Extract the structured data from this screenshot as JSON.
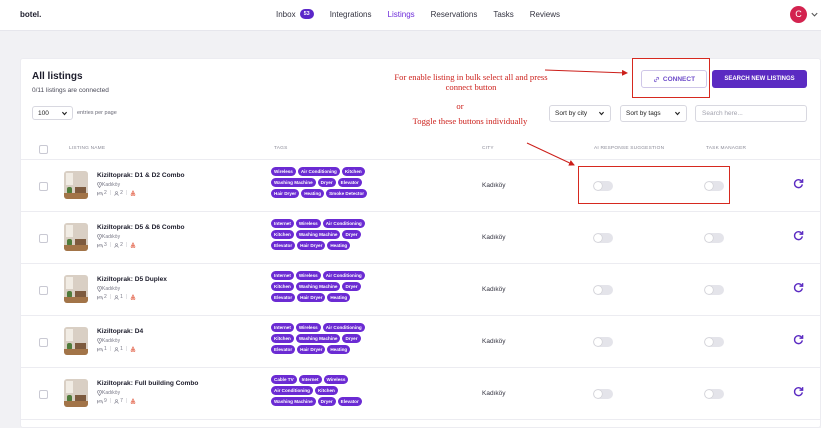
{
  "app": {
    "brand": "botel.",
    "nav": [
      {
        "label": "Inbox",
        "badge": "53"
      },
      {
        "label": "Integrations"
      },
      {
        "label": "Listings",
        "active": true
      },
      {
        "label": "Reservations"
      },
      {
        "label": "Tasks"
      },
      {
        "label": "Reviews"
      }
    ],
    "avatar_initial": "C"
  },
  "page": {
    "title": "All listings",
    "subtitle": "0/11 listings are connected",
    "per_page_value": "100",
    "per_page_label": "entries per page",
    "connect_label": "CONNECT",
    "search_new_label": "SEARCH NEW LISTINGS",
    "sort_city": "Sort by city",
    "sort_tags": "Sort by tags",
    "search_placeholder": "Search here..."
  },
  "table": {
    "headers": {
      "name": "LISTING NAME",
      "tags": "TAGS",
      "city": "CITY",
      "ai": "AI RESPONSE SUGGESTION",
      "task": "TASK MANAGER"
    },
    "rows": [
      {
        "name": "Kiziltoprak: D1 & D2 Combo",
        "location": "Kadıköy",
        "guests": "2",
        "rooms": "2",
        "city": "Kadıköy",
        "tags": [
          "Wireless",
          "Air Conditioning",
          "Kitchen",
          "Washing Machine",
          "Dryer",
          "Elevator",
          "Hair Dryer",
          "Heating",
          "Smoke Detector"
        ]
      },
      {
        "name": "Kiziltoprak: D5 & D6 Combo",
        "location": "Kadıköy",
        "guests": "3",
        "rooms": "2",
        "city": "Kadıköy",
        "tags": [
          "Internet",
          "Wireless",
          "Air Conditioning",
          "Kitchen",
          "Washing Machine",
          "Dryer",
          "Elevator",
          "Hair Dryer",
          "Heating"
        ]
      },
      {
        "name": "Kiziltoprak: D5 Duplex",
        "location": "Kadıköy",
        "guests": "2",
        "rooms": "1",
        "city": "Kadıköy",
        "tags": [
          "Internet",
          "Wireless",
          "Air Conditioning",
          "Kitchen",
          "Washing Machine",
          "Dryer",
          "Elevator",
          "Hair Dryer",
          "Heating"
        ]
      },
      {
        "name": "Kiziltoprak: D4",
        "location": "Kadıköy",
        "guests": "1",
        "rooms": "1",
        "city": "Kadıköy",
        "tags": [
          "Internet",
          "Wireless",
          "Air Conditioning",
          "Kitchen",
          "Washing Machine",
          "Dryer",
          "Elevator",
          "Hair Dryer",
          "Heating"
        ]
      },
      {
        "name": "Kiziltoprak: Full building Combo",
        "location": "Kadıköy",
        "guests": "9",
        "rooms": "7",
        "city": "Kadıköy",
        "tags": [
          "Cable TV",
          "Internet",
          "Wireless",
          "Air Conditioning",
          "Kitchen",
          "Washing Machine",
          "Dryer",
          "Elevator"
        ]
      }
    ]
  },
  "annotations": {
    "bulk": "For enable listing in bulk select all and press connect button",
    "or": "or",
    "toggle": "Toggle these buttons individually"
  },
  "colors": {
    "accent": "#5b2bc2",
    "tag": "#6b2bd3",
    "annotation": "#cc1f1a",
    "avatar": "#d3234f"
  }
}
